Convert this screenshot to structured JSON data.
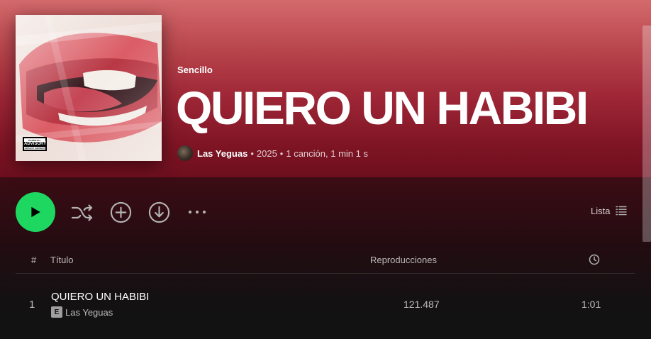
{
  "colors": {
    "accent_green": "#1ed760",
    "hero_top": "#d46a6c",
    "hero_bottom": "#6e0f1e",
    "background": "#121212"
  },
  "album": {
    "type_label": "Sencillo",
    "title": "QUIERO UN HABIBI",
    "artist": "Las Yeguas",
    "meta_year": "2025",
    "meta_tracks": "1 canción, 1 min 1 s",
    "cover_icon": "album-cover-lips",
    "advisory": {
      "line1": "PARENTAL",
      "line2": "ADVISORY",
      "line3": "EXPLICIT CONTENT"
    }
  },
  "actions": {
    "play_icon": "play-icon",
    "shuffle_icon": "shuffle-icon",
    "add_icon": "add-circle-icon",
    "download_icon": "download-icon",
    "more_icon": "more-icon",
    "view_label": "Lista",
    "view_icon": "list-view-icon"
  },
  "table": {
    "headers": {
      "number": "#",
      "title": "Título",
      "plays": "Reproducciones",
      "duration_icon": "clock-icon"
    },
    "rows": [
      {
        "number": "1",
        "title": "QUIERO UN HABIBI",
        "explicit": "E",
        "artist": "Las Yeguas",
        "plays": "121.487",
        "duration": "1:01"
      }
    ]
  }
}
